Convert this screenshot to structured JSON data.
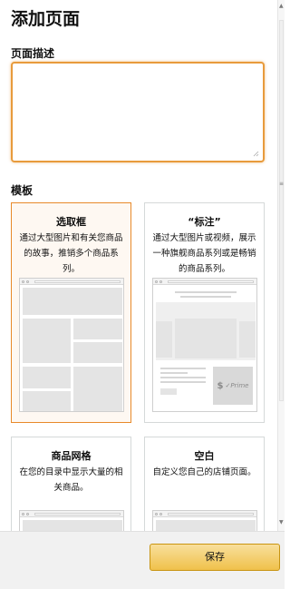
{
  "page": {
    "title": "添加页面"
  },
  "description": {
    "label": "页面描述",
    "value": ""
  },
  "templates": {
    "label": "模板",
    "items": [
      {
        "title": "选取框",
        "desc": "通过大型图片和有关您商品的故事，推销多个商品系列。",
        "selected": true
      },
      {
        "title": "“标注”",
        "desc": "通过大型图片或视频，展示一种旗舰商品系列或是畅销的商品系列。",
        "selected": false
      },
      {
        "title": "商品网格",
        "desc": "在您的目录中显示大量的相关商品。",
        "selected": false
      },
      {
        "title": "空白",
        "desc": "自定义您自己的店铺页面。",
        "selected": false
      }
    ],
    "prime_badge": "✓Prime",
    "dollar_sign": "$"
  },
  "footer": {
    "save_label": "保存"
  },
  "colors": {
    "accent": "#e88a2a",
    "button_top": "#f8df9c",
    "button_bottom": "#f0c14b"
  }
}
